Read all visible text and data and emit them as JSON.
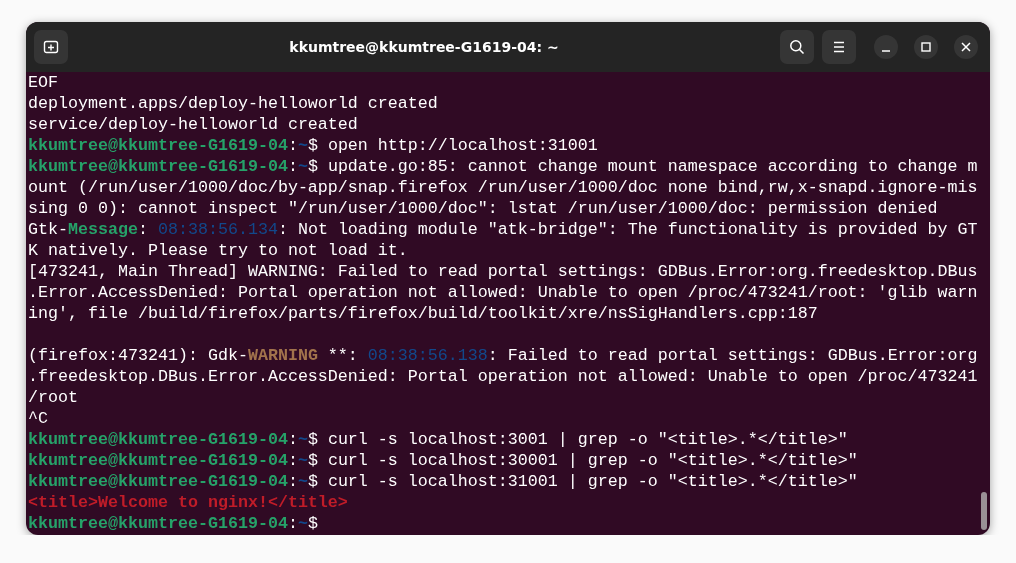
{
  "window": {
    "title": "kkumtree@kkumtree-G1619-04: ~"
  },
  "terminal": {
    "rows": [
      {
        "segments": [
          {
            "kind": "text",
            "text": "EOF"
          }
        ]
      },
      {
        "segments": [
          {
            "kind": "text",
            "text": "deployment.apps/deploy-helloworld created"
          }
        ]
      },
      {
        "segments": [
          {
            "kind": "text",
            "text": "service/deploy-helloworld created"
          }
        ]
      },
      {
        "segments": [
          {
            "kind": "user",
            "text": "kkumtree@kkumtree-G1619-04"
          },
          {
            "kind": "text",
            "text": ":"
          },
          {
            "kind": "path",
            "text": "~"
          },
          {
            "kind": "text",
            "text": "$ open http://localhost:31001"
          }
        ]
      },
      {
        "segments": [
          {
            "kind": "user",
            "text": "kkumtree@kkumtree-G1619-04"
          },
          {
            "kind": "text",
            "text": ":"
          },
          {
            "kind": "path",
            "text": "~"
          },
          {
            "kind": "text",
            "text": "$ update.go:85: cannot change mount namespace according to change m"
          }
        ]
      },
      {
        "segments": [
          {
            "kind": "text",
            "text": "ount (/run/user/1000/doc/by-app/snap.firefox /run/user/1000/doc none bind,rw,x-snapd.ignore-mis"
          }
        ]
      },
      {
        "segments": [
          {
            "kind": "text",
            "text": "sing 0 0): cannot inspect \"/run/user/1000/doc\": lstat /run/user/1000/doc: permission denied"
          }
        ]
      },
      {
        "segments": [
          {
            "kind": "text",
            "text": "Gtk-"
          },
          {
            "kind": "message",
            "text": "Message"
          },
          {
            "kind": "text",
            "text": ": "
          },
          {
            "kind": "timestamp",
            "text": "08:38:56.134"
          },
          {
            "kind": "text",
            "text": ": Not loading module \"atk-bridge\": The functionality is provided by GT"
          }
        ]
      },
      {
        "segments": [
          {
            "kind": "text",
            "text": "K natively. Please try to not load it."
          }
        ]
      },
      {
        "segments": [
          {
            "kind": "text",
            "text": "[473241, Main Thread] WARNING: Failed to read portal settings: GDBus.Error:org.freedesktop.DBus"
          }
        ]
      },
      {
        "segments": [
          {
            "kind": "text",
            "text": ".Error.AccessDenied: Portal operation not allowed: Unable to open /proc/473241/root: 'glib warn"
          }
        ]
      },
      {
        "segments": [
          {
            "kind": "text",
            "text": "ing', file /build/firefox/parts/firefox/build/toolkit/xre/nsSigHandlers.cpp:187"
          }
        ]
      },
      {
        "blank_line_before": true,
        "segments": [
          {
            "kind": "text",
            "text": "(firefox:473241): Gdk-"
          },
          {
            "kind": "warning",
            "text": "WARNING"
          },
          {
            "kind": "text",
            "text": " **: "
          },
          {
            "kind": "timestamp",
            "text": "08:38:56.138"
          },
          {
            "kind": "text",
            "text": ": Failed to read portal settings: GDBus.Error:org"
          }
        ]
      },
      {
        "segments": [
          {
            "kind": "text",
            "text": ".freedesktop.DBus.Error.AccessDenied: Portal operation not allowed: Unable to open /proc/473241"
          }
        ]
      },
      {
        "segments": [
          {
            "kind": "text",
            "text": "/root"
          }
        ]
      },
      {
        "segments": [
          {
            "kind": "text",
            "text": "^C"
          }
        ]
      },
      {
        "segments": [
          {
            "kind": "user",
            "text": "kkumtree@kkumtree-G1619-04"
          },
          {
            "kind": "text",
            "text": ":"
          },
          {
            "kind": "path",
            "text": "~"
          },
          {
            "kind": "text",
            "text": "$ curl -s localhost:3001 | grep -o \"<title>.*</title>\""
          }
        ]
      },
      {
        "segments": [
          {
            "kind": "user",
            "text": "kkumtree@kkumtree-G1619-04"
          },
          {
            "kind": "text",
            "text": ":"
          },
          {
            "kind": "path",
            "text": "~"
          },
          {
            "kind": "text",
            "text": "$ curl -s localhost:30001 | grep -o \"<title>.*</title>\""
          }
        ]
      },
      {
        "segments": [
          {
            "kind": "user",
            "text": "kkumtree@kkumtree-G1619-04"
          },
          {
            "kind": "text",
            "text": ":"
          },
          {
            "kind": "path",
            "text": "~"
          },
          {
            "kind": "text",
            "text": "$ curl -s localhost:31001 | grep -o \"<title>.*</title>\""
          }
        ]
      },
      {
        "segments": [
          {
            "kind": "match",
            "text": "<title>Welcome to nginx!</title>"
          }
        ]
      },
      {
        "segments": [
          {
            "kind": "user",
            "text": "kkumtree@kkumtree-G1619-04"
          },
          {
            "kind": "text",
            "text": ":"
          },
          {
            "kind": "path",
            "text": "~"
          },
          {
            "kind": "text",
            "text": "$"
          }
        ]
      }
    ]
  }
}
